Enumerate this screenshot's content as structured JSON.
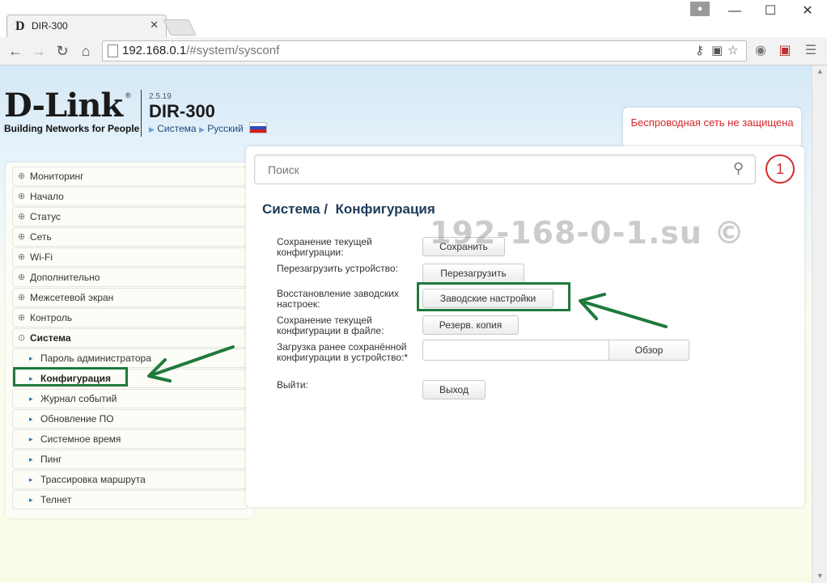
{
  "browser": {
    "tab_title": "DIR-300",
    "tab_icon": "D",
    "tab_close": "✕",
    "url_host": "192.168.0.1",
    "url_path": "/#system/sysconf",
    "window_minimize": "—",
    "window_maximize": "☐",
    "window_close": "✕"
  },
  "header": {
    "brand": "D-Link",
    "brand_reg": "®",
    "tagline": "Building Networks for People",
    "firmware_version": "2.5.19",
    "model": "DIR-300",
    "crumb_system": "Система",
    "crumb_language": "Русский"
  },
  "notification": {
    "text": "Беспроводная сеть не защищена",
    "count": "1",
    "color": "#d6262a"
  },
  "sidebar": {
    "items": [
      {
        "label": "Мониторинг",
        "icon": "circle-chevron-icon",
        "sub": false
      },
      {
        "label": "Начало",
        "icon": "circle-chevron-icon",
        "sub": false
      },
      {
        "label": "Статус",
        "icon": "circle-chevron-icon",
        "sub": false
      },
      {
        "label": "Сеть",
        "icon": "circle-chevron-icon",
        "sub": false
      },
      {
        "label": "Wi-Fi",
        "icon": "circle-chevron-icon",
        "sub": false
      },
      {
        "label": "Дополнительно",
        "icon": "circle-chevron-icon",
        "sub": false
      },
      {
        "label": "Межсетевой экран",
        "icon": "circle-chevron-icon",
        "sub": false
      },
      {
        "label": "Контроль",
        "icon": "circle-chevron-icon",
        "sub": false
      },
      {
        "label": "Система",
        "icon": "circle-chevron-icon",
        "sub": false
      },
      {
        "label": "Пароль администратора",
        "icon": "triangle-right-icon",
        "sub": true
      },
      {
        "label": "Конфигурация",
        "icon": "triangle-right-icon",
        "sub": true
      },
      {
        "label": "Журнал событий",
        "icon": "triangle-right-icon",
        "sub": true
      },
      {
        "label": "Обновление ПО",
        "icon": "triangle-right-icon",
        "sub": true
      },
      {
        "label": "Системное время",
        "icon": "triangle-right-icon",
        "sub": true
      },
      {
        "label": "Пинг",
        "icon": "triangle-right-icon",
        "sub": true
      },
      {
        "label": "Трассировка маршрута",
        "icon": "triangle-right-icon",
        "sub": true
      },
      {
        "label": "Телнет",
        "icon": "triangle-right-icon",
        "sub": true
      }
    ]
  },
  "main": {
    "search_placeholder": "Поиск",
    "title_section": "Система /",
    "title_page": "Конфигурация",
    "rows": [
      {
        "label": "Сохранение текущей конфигурации:",
        "button": "Сохранить"
      },
      {
        "label": "Перезагрузить устройство:",
        "button": "Перезагрузить"
      },
      {
        "label": "Восстановление заводских настроек:",
        "button": "Заводские настройки"
      },
      {
        "label": "Сохранение текущей конфигурации в файле:",
        "button": "Резерв. копия"
      },
      {
        "label": "Загрузка ранее сохранённой конфигурации в устройство:*",
        "button": "Обзор"
      },
      {
        "label": "Выйти:",
        "button": "Выход"
      }
    ]
  },
  "watermark": "192-168-0-1.su ©",
  "colors": {
    "highlight": "#1f7a3c",
    "alert": "#d42a2a",
    "title": "#1d3b58"
  }
}
